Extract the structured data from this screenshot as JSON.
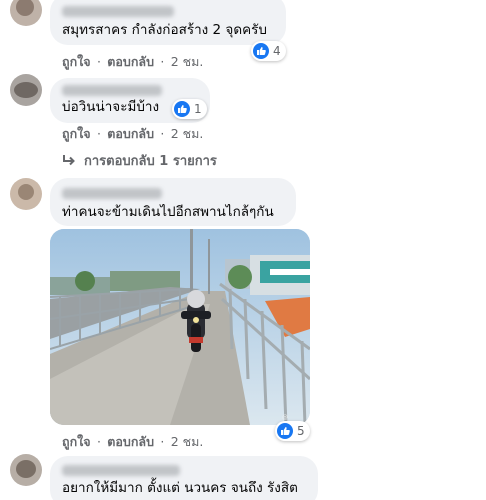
{
  "comments": [
    {
      "text": "สมุทรสาคร กำลังก่อสร้าง 2 จุดครับ",
      "reactions": "4",
      "actions": {
        "like": "ถูกใจ",
        "reply": "ตอบกลับ",
        "time": "2 ชม."
      }
    },
    {
      "text": "บ่อวินน่าจะมีบ้าง",
      "reactions": "1",
      "actions": {
        "like": "ถูกใจ",
        "reply": "ตอบกลับ",
        "time": "2 ชม."
      },
      "view_replies": "การตอบกลับ 1 รายการ"
    },
    {
      "text": "ท่าคนจะข้ามเดินไปอีกสพานไกล้ๆกัน",
      "reactions": "5",
      "actions": {
        "like": "ถูกใจ",
        "reply": "ตอบกลับ",
        "time": "2 ชม."
      },
      "has_photo": true
    },
    {
      "text": "อยากให้มีมาก ตั้งแต่ นวนคร จนถึง รังสิต"
    }
  ],
  "separator": "·",
  "icons": {
    "reaction": "like-icon",
    "reply_arrow": "reply-arrow-icon"
  },
  "colors": {
    "bubble": "#f0f2f5",
    "like_blue": "#1877f2",
    "muted_text": "#65676b"
  }
}
